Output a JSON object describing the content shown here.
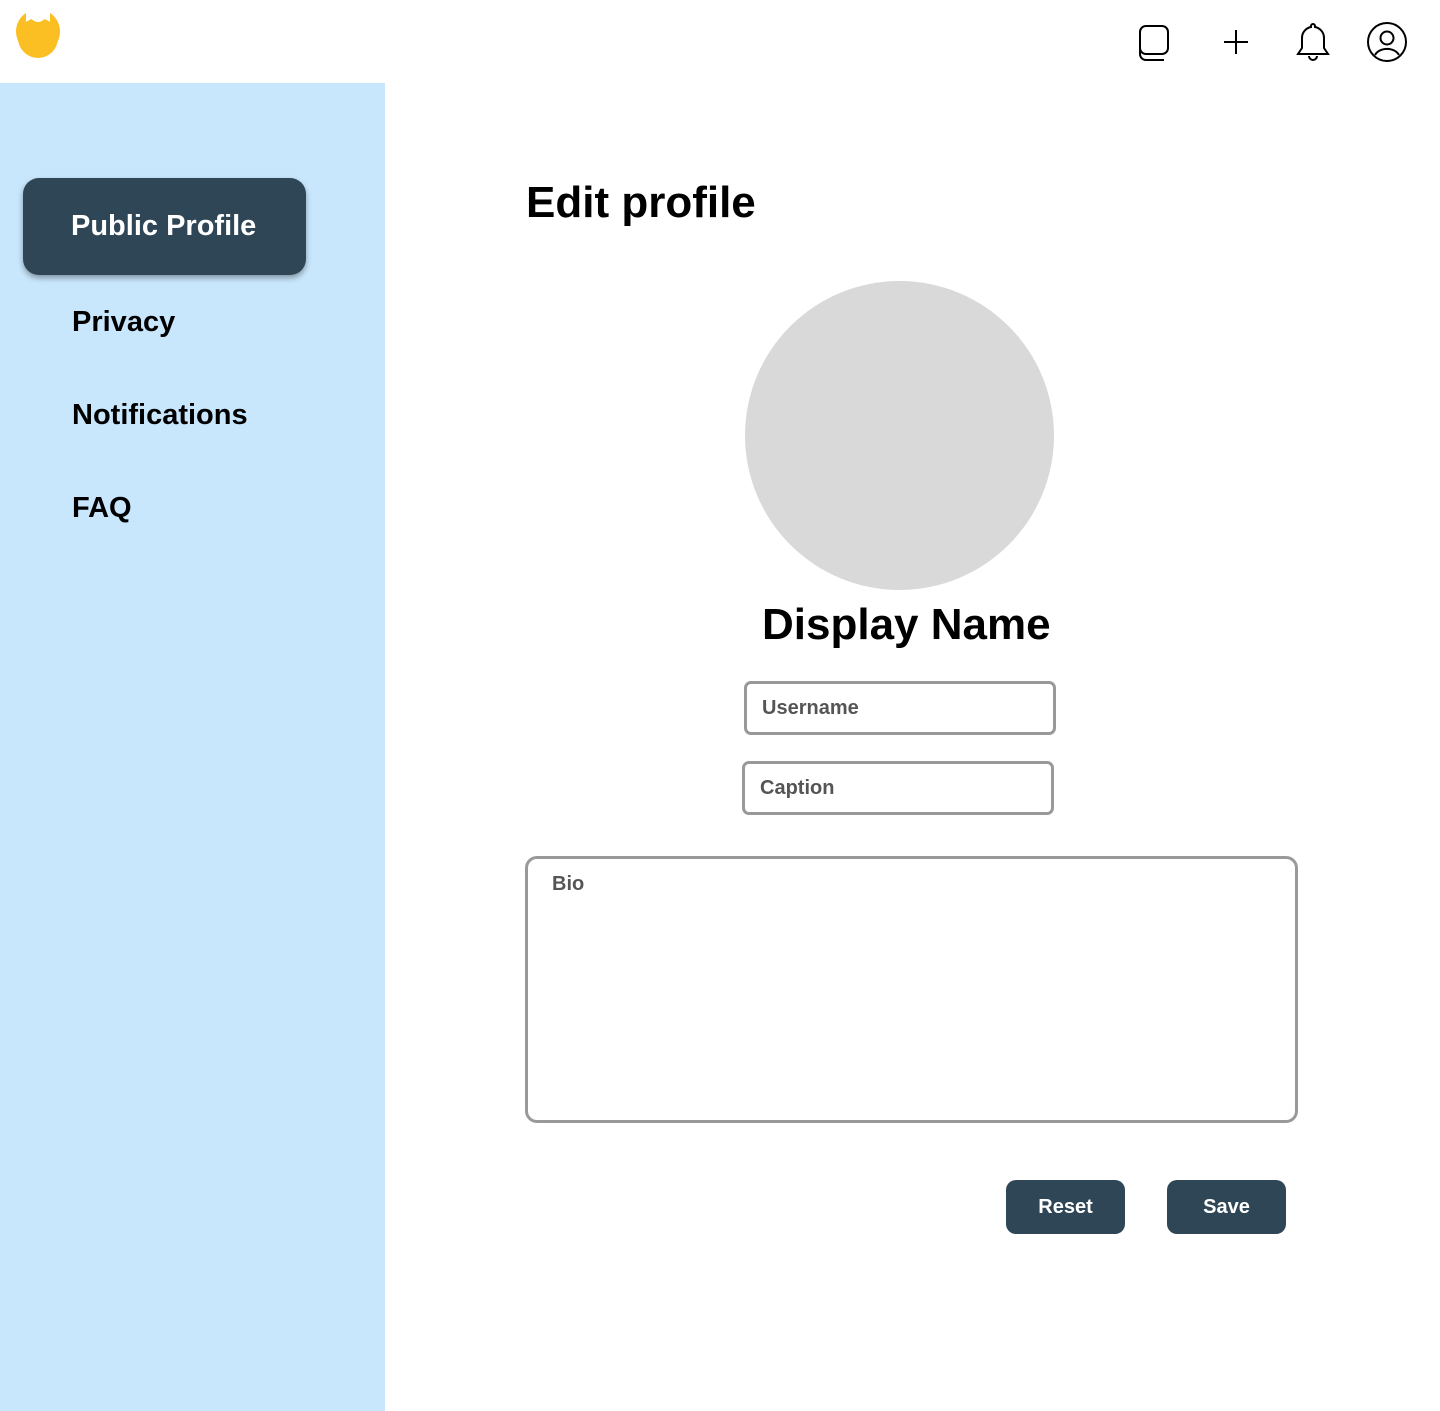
{
  "header": {
    "icons": [
      "logo-icon",
      "layers-icon",
      "plus-icon",
      "bell-icon",
      "user-icon"
    ],
    "brand_color": "#fbbf24"
  },
  "sidebar": {
    "items": [
      {
        "label": "Public Profile",
        "active": true
      },
      {
        "label": "Privacy"
      },
      {
        "label": "Notifications"
      },
      {
        "label": "FAQ"
      }
    ],
    "background": "#c8e6fc",
    "active_color": "#2f4656"
  },
  "main": {
    "title": "Edit profile",
    "display_name": "Display Name",
    "username_placeholder": "Username",
    "caption_placeholder": "Caption",
    "bio_placeholder": "Bio",
    "reset_label": "Reset",
    "save_label": "Save"
  }
}
